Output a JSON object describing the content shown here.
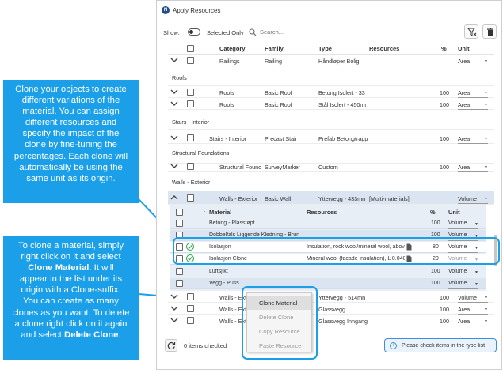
{
  "window": {
    "title": "Apply Resources",
    "logo": "N"
  },
  "toolbar": {
    "show_label": "Show:",
    "selected_only_label": "Selected Only",
    "search_placeholder": "Search..."
  },
  "header": {
    "category": "Category",
    "family": "Family",
    "type": "Type",
    "resources": "Resources",
    "pct": "%",
    "unit": "Unit"
  },
  "rows": {
    "r0": {
      "category": "Railings",
      "family": "Railing",
      "type": "Håndløper Bolig",
      "pct": "",
      "unit": "Area"
    },
    "g1": {
      "label": "Roofs"
    },
    "r1": {
      "category": "Roofs",
      "family": "Basic Roof",
      "type": "Betong Isolert - 33",
      "pct": "100",
      "unit": "Area"
    },
    "r2": {
      "category": "Roofs",
      "family": "Basic Roof",
      "type": "Stål Isolert - 450mr",
      "pct": "100",
      "unit": "Area"
    },
    "g2": {
      "label": "Stairs - Interior"
    },
    "r3": {
      "category": "Stairs - Interior",
      "family": "Precast Stair",
      "type": "Prefab Betongtrapp",
      "pct": "100",
      "unit": "Area"
    },
    "g3": {
      "label": "Structural Foundations"
    },
    "r4": {
      "category": "Structural Founc",
      "family": "SurveyMarker",
      "type": "Custom",
      "pct": "100",
      "unit": "Area"
    },
    "g4": {
      "label": "Walls - Exterior"
    },
    "r5": {
      "category": "Walls - Exterior",
      "family": "Basic Wall",
      "type": "Yttervegg - 433mn",
      "resources": "[Multi-materials]",
      "pct": "",
      "unit": "Volume"
    },
    "r6": {
      "category": "Walls - Ext",
      "family": "",
      "type": "Yttervegg - 514mn",
      "pct": "100",
      "unit": "Volume"
    },
    "r7": {
      "category": "Walls - Ext",
      "family": "",
      "type": "Glassvegg",
      "pct": "100",
      "unit": "Area"
    },
    "r8": {
      "category": "Walls - Ext",
      "family": "",
      "type": "Glassvegg Inngang",
      "pct": "100",
      "unit": "Area"
    }
  },
  "sub": {
    "header": {
      "material": "Material",
      "resources": "Resources",
      "pct": "%",
      "unit": "Unit"
    },
    "m0": {
      "material": "Betong - Plasstøpt",
      "resources": "",
      "pct": "100",
      "unit": "Volume"
    },
    "m1": {
      "material": "Dobbelfals Liggende Kledning - Brun",
      "resources": "",
      "pct": "100",
      "unit": "Volume"
    },
    "m2": {
      "material": "Isolasjon",
      "resources": "Insulation, rock wool/mineral wool, above",
      "pct": "80",
      "unit": "Volume"
    },
    "m3": {
      "material": "Isolasjon Clone",
      "resources": "Mineral wool (facade insulation), L  0.040",
      "pct": "20",
      "unit": "Volume"
    },
    "m4": {
      "material": "Luftsjikt",
      "resources": "",
      "pct": "100",
      "unit": "Volume"
    },
    "m5": {
      "material": "Vegg - Puss",
      "resources": "",
      "pct": "100",
      "unit": "Volume"
    }
  },
  "context_menu": {
    "clone": "Clone Material",
    "delete": "Delete Clone",
    "copy": "Copy Resource",
    "paste": "Paste Resource"
  },
  "footer": {
    "items_checked": "0 items checked",
    "info": "Please check items in the type list"
  },
  "callouts": {
    "top": {
      "l1": "Clone your objects to create",
      "l2": "different variations of the",
      "l3": "material. You can assign",
      "l4": "different resources and",
      "l5": "specify the impact of the",
      "l6": "clone by fine-tuning the",
      "l7": "percentages. Each clone will",
      "l8": "automatically be using the",
      "l9": "same unit as its origin."
    },
    "bottom": {
      "l1": "To clone a material, simply",
      "l2": "right click on it and select",
      "l3_bold": "Clone Material",
      "l3_rest": ". It will",
      "l4": "appear in the list under its",
      "l5": "origin with a Clone-suffix.",
      "l6": "You can create as many",
      "l7": "clones as you want. To delete",
      "l8": "a clone right click on it again",
      "l9_pre": "and select ",
      "l9_bold": "Delete Clone",
      "l9_post": "."
    }
  },
  "colors": {
    "accent": "#1a9fe8",
    "selected_row": "#dbe4f1",
    "ok_green": "#28a745"
  }
}
